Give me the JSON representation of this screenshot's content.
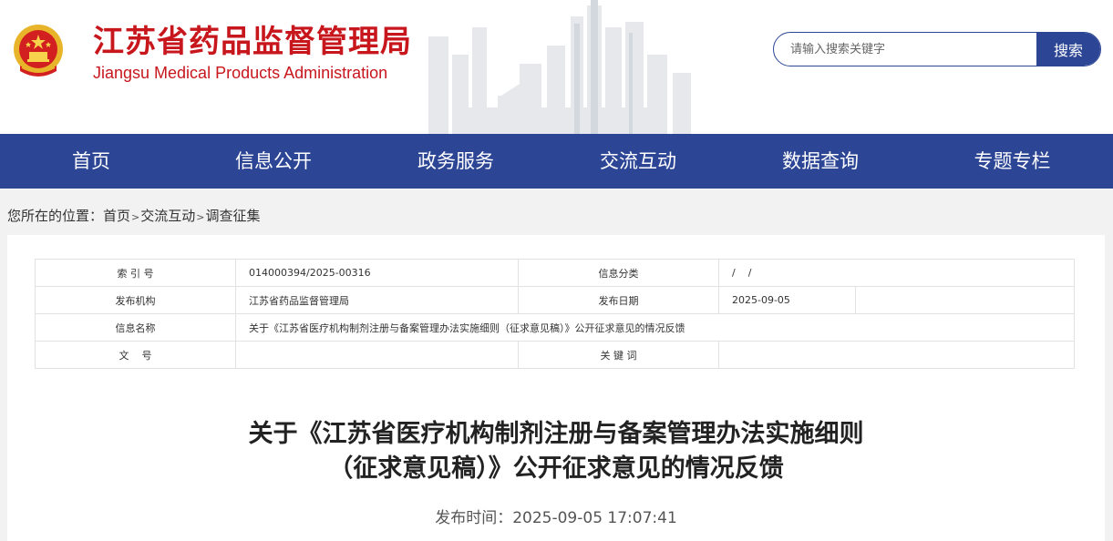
{
  "header": {
    "site_title": "江苏省药品监督管理局",
    "site_subtitle": "Jiangsu Medical Products Administration",
    "search_placeholder": "请输入搜索关键字",
    "search_button": "搜索"
  },
  "nav": {
    "items": [
      "首页",
      "信息公开",
      "政务服务",
      "交流互动",
      "数据查询",
      "专题专栏"
    ]
  },
  "breadcrumb": {
    "label": "您所在的位置：",
    "items": [
      "首页",
      "交流互动",
      "调查征集"
    ],
    "separator": ">"
  },
  "meta": {
    "index_label": "索 引 号",
    "index_value": "014000394/2025-00316",
    "category_label": "信息分类",
    "category_value": "/    /",
    "org_label": "发布机构",
    "org_value": "江苏省药品监督管理局",
    "date_label": "发布日期",
    "date_value": "2025-09-05",
    "name_label": "信息名称",
    "name_value": "关于《江苏省医疗机构制剂注册与备案管理办法实施细则（征求意见稿）》公开征求意见的情况反馈",
    "docno_label": "文    号",
    "docno_value": "",
    "keywords_label": "关 键 词",
    "keywords_value": ""
  },
  "article": {
    "title_line1": "关于《江苏省医疗机构制剂注册与备案管理办法实施细则",
    "title_line2": "（征求意见稿）》公开征求意见的情况反馈",
    "publish_label": "发布时间：",
    "publish_time": "2025-09-05 17:07:41"
  },
  "colors": {
    "brand_red": "#c8161d",
    "nav_blue": "#2c4595"
  }
}
